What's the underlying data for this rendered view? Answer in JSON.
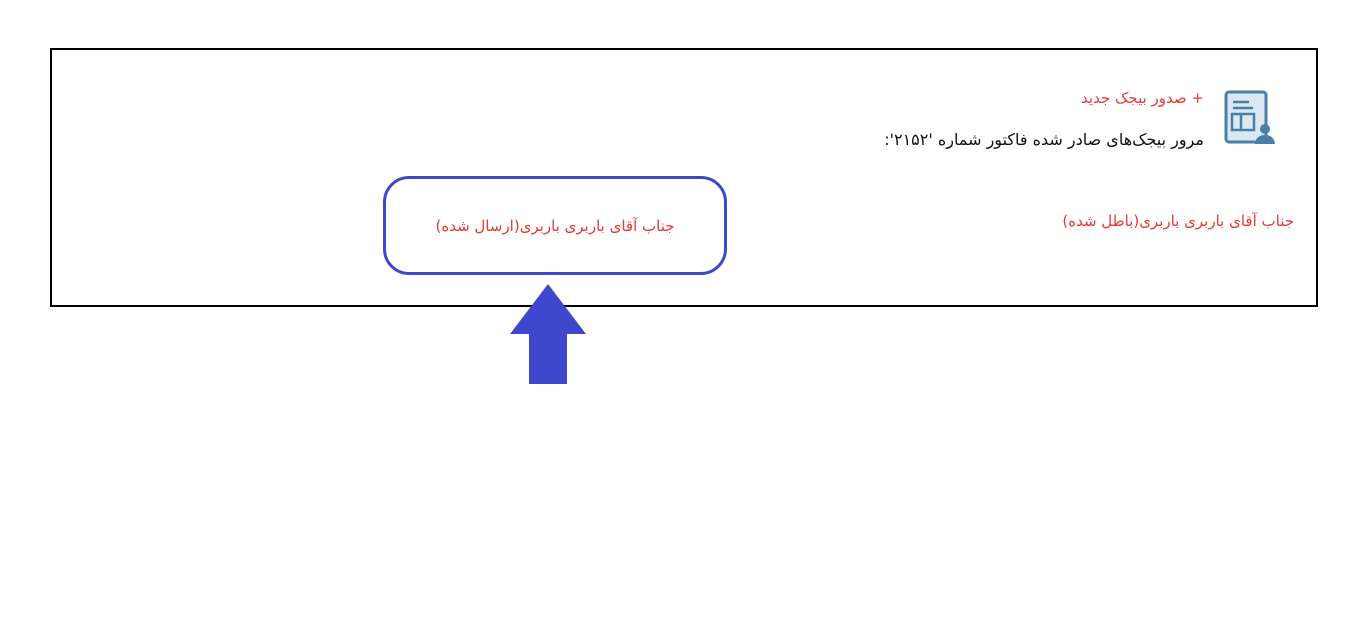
{
  "header": {
    "new_bijak_label": "+ صدور بیجک جدید",
    "title": "مرور بیجک‌های صادر شده فاکتور شماره '۲۱۵۲':"
  },
  "bijaks": [
    {
      "label": "جناب آقای باربری باربری(باطل شده)",
      "status": "باطل شده"
    },
    {
      "label": "جناب آقای باربری باربری(ارسال شده)",
      "status": "ارسال شده"
    }
  ],
  "colors": {
    "link": "#e53935",
    "highlight": "#3f48cc",
    "icon": "#4a7fa6"
  },
  "icons": {
    "document": "document-user-icon",
    "pointer": "up-arrow-icon"
  }
}
